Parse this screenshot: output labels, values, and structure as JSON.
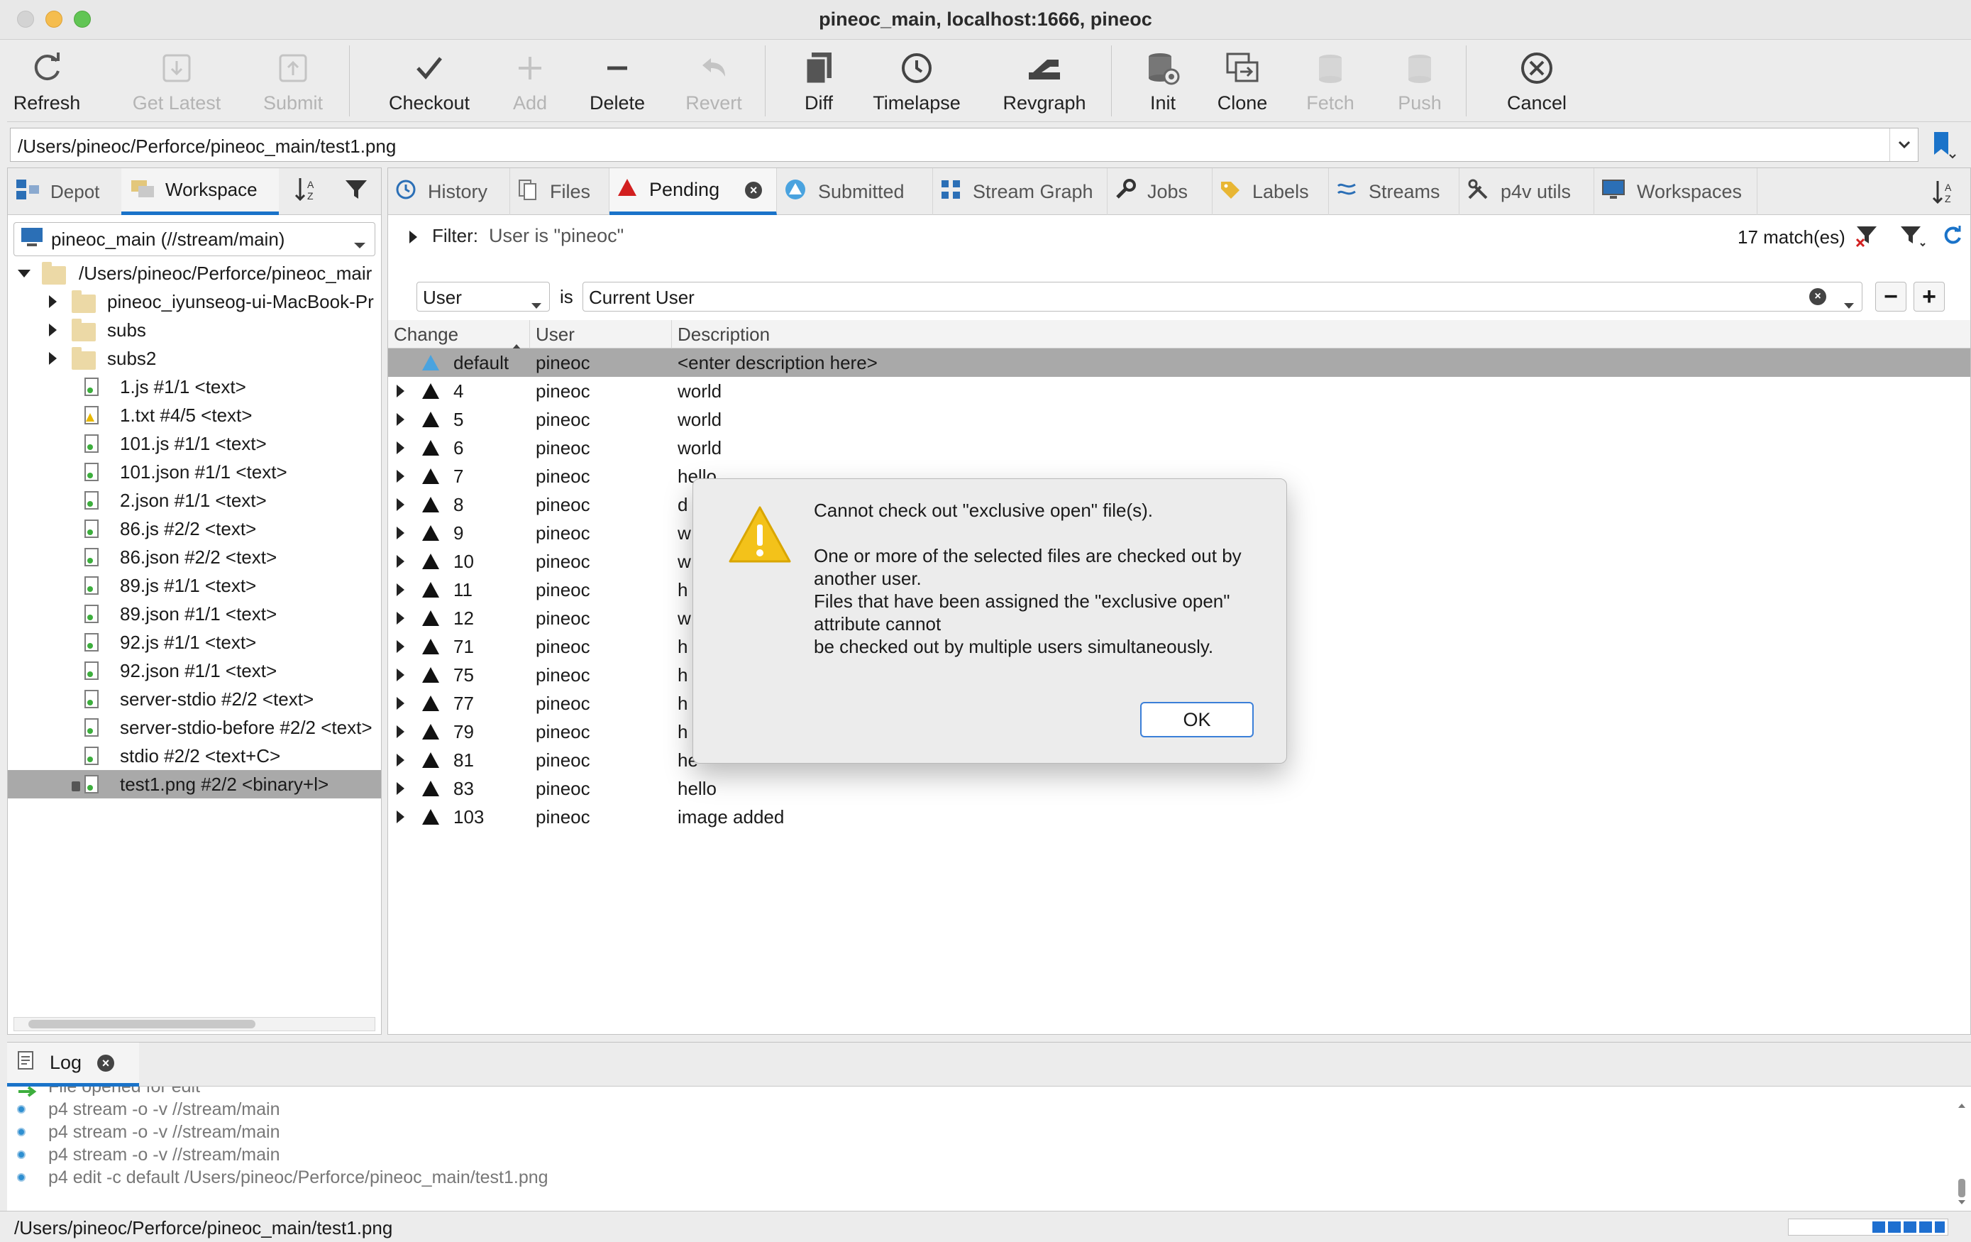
{
  "window": {
    "title": "pineoc_main,  localhost:1666,  pineoc"
  },
  "toolbar": {
    "buttons": [
      {
        "label": "Refresh",
        "icon": "refresh-icon",
        "enabled": true
      },
      {
        "label": "Get Latest",
        "icon": "get-latest-icon",
        "enabled": false
      },
      {
        "label": "Submit",
        "icon": "submit-icon",
        "enabled": false
      },
      {
        "label": "Checkout",
        "icon": "checkmark-icon",
        "enabled": true
      },
      {
        "label": "Add",
        "icon": "plus-icon",
        "enabled": false
      },
      {
        "label": "Delete",
        "icon": "minus-icon",
        "enabled": true
      },
      {
        "label": "Revert",
        "icon": "undo-icon",
        "enabled": false
      },
      {
        "label": "Diff",
        "icon": "diff-icon",
        "enabled": true
      },
      {
        "label": "Timelapse",
        "icon": "clock-icon",
        "enabled": true
      },
      {
        "label": "Revgraph",
        "icon": "revgraph-icon",
        "enabled": true
      },
      {
        "label": "Init",
        "icon": "database-icon",
        "enabled": true
      },
      {
        "label": "Clone",
        "icon": "clone-icon",
        "enabled": true
      },
      {
        "label": "Fetch",
        "icon": "fetch-icon",
        "enabled": false
      },
      {
        "label": "Push",
        "icon": "push-icon",
        "enabled": false
      },
      {
        "label": "Cancel",
        "icon": "cancel-icon",
        "enabled": true
      }
    ]
  },
  "pathbar": {
    "value": "/Users/pineoc/Perforce/pineoc_main/test1.png"
  },
  "left_pane": {
    "tabs": [
      {
        "label": "Depot",
        "icon": "depot-icon"
      },
      {
        "label": "Workspace",
        "icon": "workspace-icon",
        "active": true
      }
    ],
    "workspace_select": "pineoc_main (//stream/main)",
    "tree": {
      "root": "/Users/pineoc/Perforce/pineoc_mair",
      "folders": [
        "pineoc_iyunseog-ui-MacBook-Pr",
        "subs",
        "subs2"
      ],
      "files": [
        {
          "label": "1.js #1/1 <text>"
        },
        {
          "label": "1.txt #4/5 <text>",
          "status": "warning"
        },
        {
          "label": "101.js #1/1 <text>"
        },
        {
          "label": "101.json #1/1 <text>"
        },
        {
          "label": "2.json #1/1 <text>"
        },
        {
          "label": "86.js #2/2 <text>"
        },
        {
          "label": "86.json #2/2 <text>"
        },
        {
          "label": "89.js #1/1 <text>"
        },
        {
          "label": "89.json #1/1 <text>"
        },
        {
          "label": "92.js #1/1 <text>"
        },
        {
          "label": "92.json #1/1 <text>"
        },
        {
          "label": "server-stdio #2/2 <text>"
        },
        {
          "label": "server-stdio-before #2/2 <text>"
        },
        {
          "label": "stdio #2/2 <text+C>"
        },
        {
          "label": "test1.png #2/2 <binary+l>",
          "selected": true
        }
      ]
    }
  },
  "right_pane": {
    "tabs": [
      {
        "label": "History",
        "icon": "history-icon"
      },
      {
        "label": "Files",
        "icon": "files-icon"
      },
      {
        "label": "Pending",
        "icon": "pending-icon",
        "active": true
      },
      {
        "label": "Submitted",
        "icon": "submitted-icon"
      },
      {
        "label": "Stream Graph",
        "icon": "stream-graph-icon"
      },
      {
        "label": "Jobs",
        "icon": "wrench-icon"
      },
      {
        "label": "Labels",
        "icon": "tag-icon"
      },
      {
        "label": "Streams",
        "icon": "streams-icon"
      },
      {
        "label": "p4v utils",
        "icon": "tools-icon"
      },
      {
        "label": "Workspaces",
        "icon": "monitor-icon"
      }
    ],
    "filter": {
      "label": "Filter:",
      "value": "User is \"pineoc\"",
      "matches": "17 match(es)",
      "field": "User",
      "operator": "is",
      "criteria_value": "Current User"
    },
    "columns": [
      "Change",
      "User",
      "Description"
    ],
    "rows": [
      {
        "change": "default",
        "user": "pineoc",
        "description": "<enter description here>",
        "selected": true
      },
      {
        "change": "4",
        "user": "pineoc",
        "description": "world"
      },
      {
        "change": "5",
        "user": "pineoc",
        "description": "world"
      },
      {
        "change": "6",
        "user": "pineoc",
        "description": "world"
      },
      {
        "change": "7",
        "user": "pineoc",
        "description": "hello"
      },
      {
        "change": "8",
        "user": "pineoc",
        "description": "d"
      },
      {
        "change": "9",
        "user": "pineoc",
        "description": "w"
      },
      {
        "change": "10",
        "user": "pineoc",
        "description": "w"
      },
      {
        "change": "11",
        "user": "pineoc",
        "description": "h"
      },
      {
        "change": "12",
        "user": "pineoc",
        "description": "w"
      },
      {
        "change": "71",
        "user": "pineoc",
        "description": "h"
      },
      {
        "change": "75",
        "user": "pineoc",
        "description": "h"
      },
      {
        "change": "77",
        "user": "pineoc",
        "description": "h"
      },
      {
        "change": "79",
        "user": "pineoc",
        "description": "h"
      },
      {
        "change": "81",
        "user": "pineoc",
        "description": "he"
      },
      {
        "change": "83",
        "user": "pineoc",
        "description": "hello"
      },
      {
        "change": "103",
        "user": "pineoc",
        "description": "image added"
      }
    ]
  },
  "dialog": {
    "icon": "warning-icon",
    "line1": "Cannot check out \"exclusive open\" file(s).",
    "line2": "One or more of the selected files are checked out by another user.",
    "line3": "Files that have been assigned the \"exclusive open\" attribute cannot",
    "line4": "be checked out by multiple users simultaneously.",
    "ok_label": "OK"
  },
  "log": {
    "tab_label": "Log",
    "lines": [
      {
        "text": "File opened for edit",
        "icon": "arrow-icon"
      },
      {
        "text": "p4 stream -o -v //stream/main"
      },
      {
        "text": "p4 stream -o -v //stream/main"
      },
      {
        "text": "p4 stream -o -v //stream/main"
      },
      {
        "text": "p4 edit -c default /Users/pineoc/Perforce/pineoc_main/test1.png"
      }
    ]
  },
  "statusbar": {
    "text": "/Users/pineoc/Perforce/pineoc_main/test1.png"
  },
  "colors": {
    "accent": "#1a73c9",
    "selection": "#a9a9a9",
    "pending_red": "#d21f1f",
    "warning": "#f3c21a"
  }
}
